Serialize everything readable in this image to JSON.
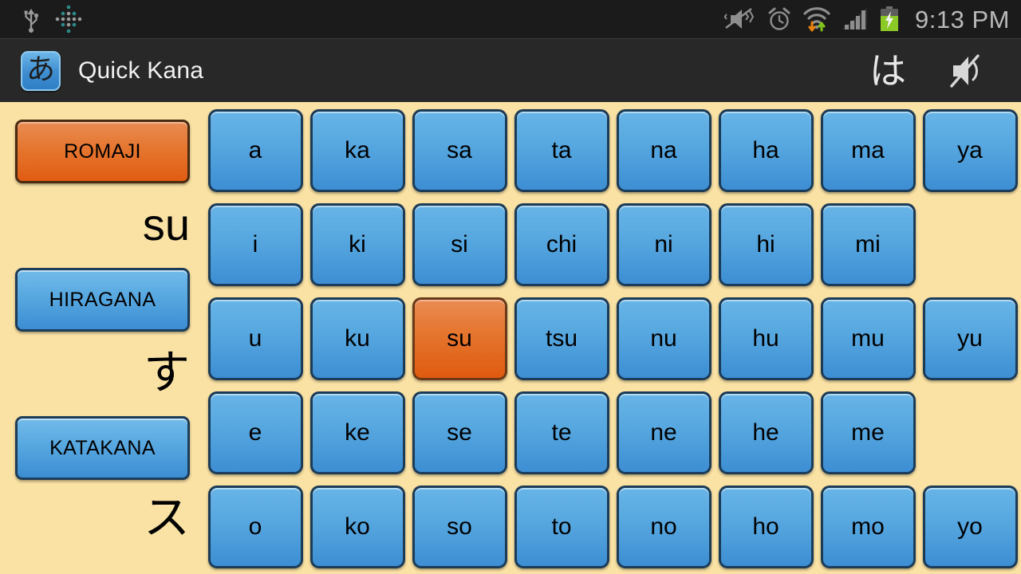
{
  "status_bar": {
    "icons": [
      "usb-icon",
      "dots-pattern-icon",
      "vibrate-off-icon",
      "alarm-clock-icon",
      "wifi-data-icon",
      "signal-bars-icon",
      "battery-charging-icon"
    ],
    "clock": "9:13 PM"
  },
  "action_bar": {
    "app_icon_glyph": "あ",
    "title": "Quick Kana",
    "kana_indicator": "は",
    "sound_icon": "speaker-muted-icon"
  },
  "sidebar": {
    "modes": [
      {
        "key": "romaji",
        "label": "ROMAJI",
        "selected": true,
        "answer": "su"
      },
      {
        "key": "hiragana",
        "label": "HIRAGANA",
        "selected": false,
        "answer": "す"
      },
      {
        "key": "katakana",
        "label": "KATAKANA",
        "selected": false,
        "answer": "ス"
      }
    ]
  },
  "grid": {
    "columns": [
      "a",
      "ka",
      "sa",
      "ta",
      "na",
      "ha",
      "ma",
      "ya"
    ],
    "rows": [
      {
        "vowel": "a",
        "cells": [
          "a",
          "ka",
          "sa",
          "ta",
          "na",
          "ha",
          "ma",
          "ya"
        ]
      },
      {
        "vowel": "i",
        "cells": [
          "i",
          "ki",
          "si",
          "chi",
          "ni",
          "hi",
          "mi",
          ""
        ]
      },
      {
        "vowel": "u",
        "cells": [
          "u",
          "ku",
          "su",
          "tsu",
          "nu",
          "hu",
          "mu",
          "yu"
        ]
      },
      {
        "vowel": "e",
        "cells": [
          "e",
          "ke",
          "se",
          "te",
          "ne",
          "he",
          "me",
          ""
        ]
      },
      {
        "vowel": "o",
        "cells": [
          "o",
          "ko",
          "so",
          "to",
          "no",
          "ho",
          "mo",
          "yo"
        ]
      }
    ],
    "selected_cell": "su"
  },
  "colors": {
    "background": "#fae2a4",
    "button_blue": "#57a8e0",
    "button_orange": "#e5762f",
    "status_bar": "#1b1b1b",
    "action_bar": "#282828",
    "battery_green": "#8bc926"
  }
}
